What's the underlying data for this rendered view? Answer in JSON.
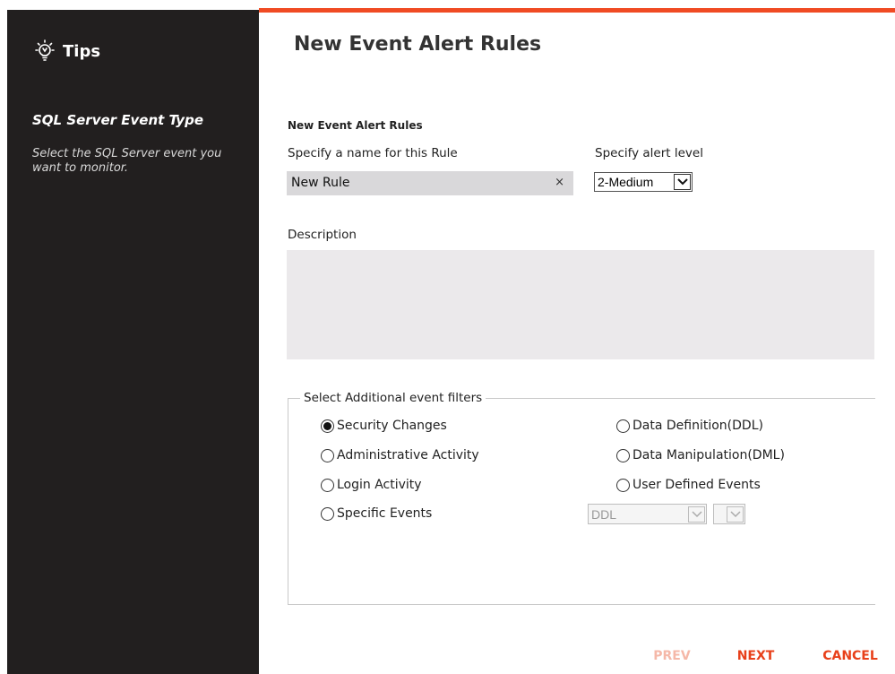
{
  "tips": {
    "title": "Tips",
    "subtitle": "SQL Server Event Type",
    "text": "Select the SQL Server event you want to monitor."
  },
  "page": {
    "title": "New Event Alert Rules",
    "section_title": "New Event Alert Rules"
  },
  "rule": {
    "name_label": "Specify a name for this Rule",
    "name_value": "New Rule",
    "clear_glyph": "×",
    "level_label": "Specify alert level",
    "level_value": "2-Medium",
    "description_label": "Description",
    "description_value": ""
  },
  "filters": {
    "legend": "Select Additional event filters",
    "options": [
      {
        "label": "Security Changes",
        "checked": true
      },
      {
        "label": "Data Definition(DDL)",
        "checked": false
      },
      {
        "label": "Administrative Activity",
        "checked": false
      },
      {
        "label": "Data Manipulation(DML)",
        "checked": false
      },
      {
        "label": "Login Activity",
        "checked": false
      },
      {
        "label": "User Defined Events",
        "checked": false
      },
      {
        "label": "Specific Events",
        "checked": false
      }
    ],
    "specific_select_value": "DDL",
    "specific_select2_value": ""
  },
  "buttons": {
    "prev": "PREV",
    "next": "NEXT",
    "cancel": "CANCEL"
  },
  "colors": {
    "accent": "#f04b23",
    "panel_bg": "#221f1f",
    "disabled": "#f5b8a8"
  },
  "icons": {
    "tips": "lightbulb-icon",
    "clear": "close-icon",
    "dropdown": "chevron-down-icon"
  }
}
